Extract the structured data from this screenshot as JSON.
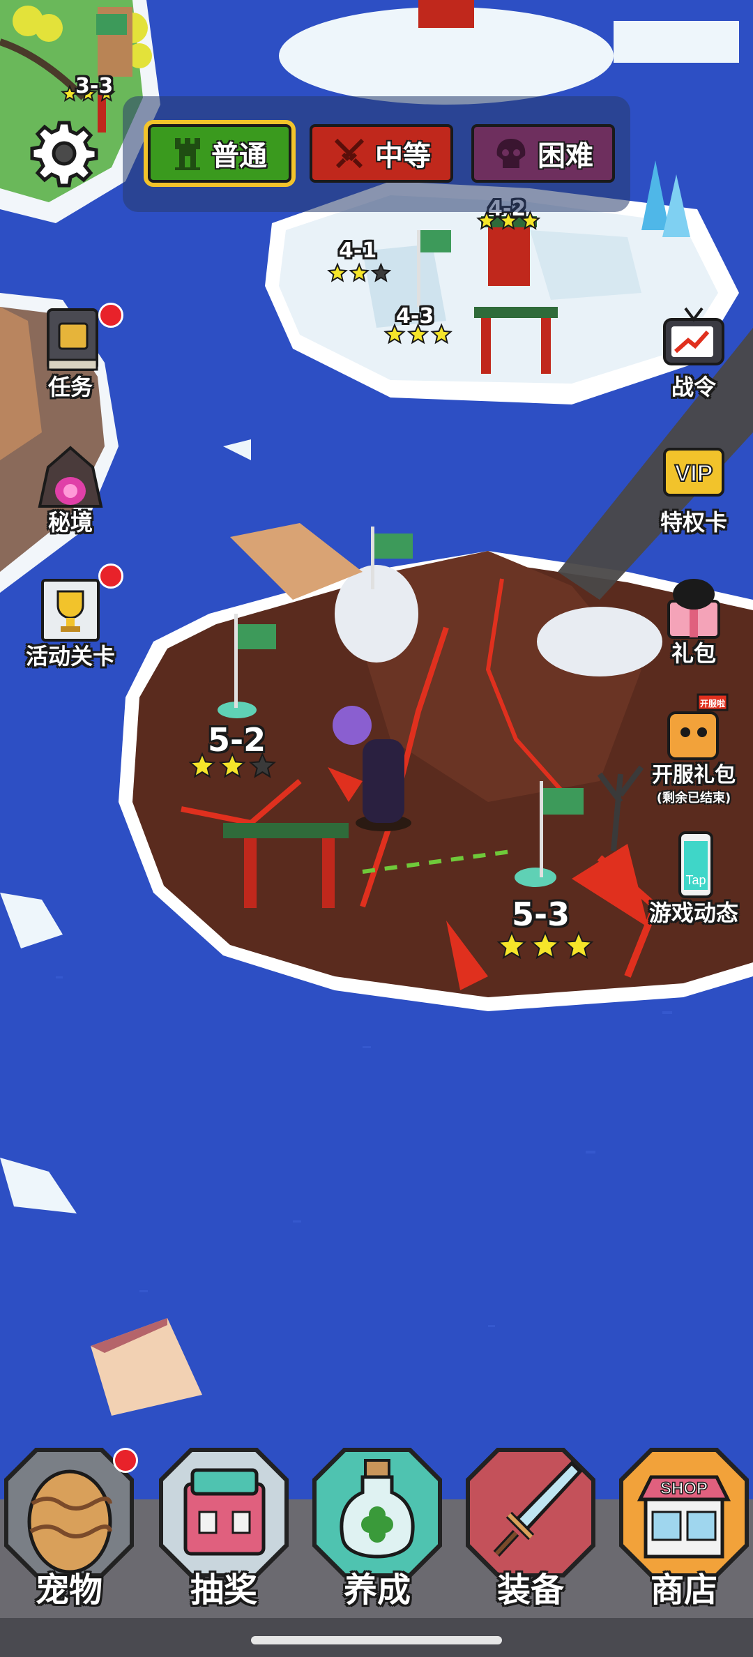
{
  "difficulty_tabs": [
    {
      "label": "普通",
      "selected": true,
      "color": "#3a9a1e"
    },
    {
      "label": "中等",
      "selected": false,
      "color": "#c0281c"
    },
    {
      "label": "困难",
      "selected": false,
      "color": "#6e2f5e"
    }
  ],
  "side_menu_left": [
    {
      "label": "任务",
      "icon": "quest-book-icon",
      "badge": true
    },
    {
      "label": "秘境",
      "icon": "secret-cave-icon",
      "badge": false
    },
    {
      "label": "活动关卡",
      "icon": "event-trophy-icon",
      "badge": true
    }
  ],
  "side_menu_right": [
    {
      "label": "战令",
      "icon": "battle-pass-tv-icon"
    },
    {
      "label": "特权卡",
      "icon": "vip-card-icon",
      "badge_text": "VIP"
    },
    {
      "label": "礼包",
      "icon": "gift-box-icon"
    },
    {
      "label": "开服礼包",
      "sublabel": "(剩余已结束)",
      "icon": "launch-gift-icon",
      "badge_text": "开服啦"
    },
    {
      "label": "游戏动态",
      "icon": "tap-phone-icon",
      "badge_text": "Tap"
    }
  ],
  "stages": [
    {
      "label": "3-3",
      "stars": 3
    },
    {
      "label": "4-1",
      "stars": 2
    },
    {
      "label": "4-2",
      "stars": 3
    },
    {
      "label": "4-3",
      "stars": 3
    },
    {
      "label": "5-2",
      "stars": 2
    },
    {
      "label": "5-3",
      "stars": 3
    }
  ],
  "bottom_nav": [
    {
      "label": "宠物",
      "icon": "pet-egg-icon",
      "badge": true
    },
    {
      "label": "抽奖",
      "icon": "lottery-box-icon",
      "badge": false
    },
    {
      "label": "养成",
      "icon": "clover-bottle-icon",
      "badge": false
    },
    {
      "label": "装备",
      "icon": "sword-icon",
      "badge": false
    },
    {
      "label": "商店",
      "icon": "shop-icon",
      "badge": false,
      "sign_text": "SHOP"
    }
  ],
  "colors": {
    "ocean": "#2d4fc4",
    "volcano": "#5a2b1e",
    "lava": "#e0301e",
    "snow": "#eef6fb",
    "badge": "#e8222a"
  }
}
